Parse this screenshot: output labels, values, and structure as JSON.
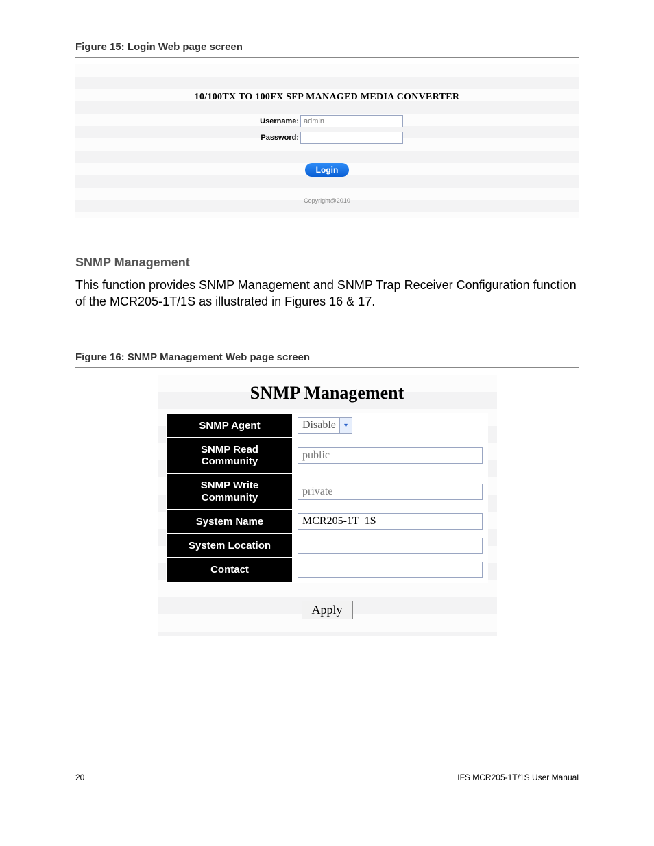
{
  "figure15": {
    "caption": "Figure 15: Login Web page screen",
    "title": "10/100TX TO 100FX SFP MANAGED MEDIA CONVERTER",
    "username_label": "Username:",
    "username_value": "admin",
    "password_label": "Password:",
    "password_value": "",
    "login_button": "Login",
    "copyright": "Copyright@2010"
  },
  "section": {
    "heading": "SNMP Management",
    "body": "This function provides SNMP Management and SNMP Trap Receiver Configuration function of the MCR205-1T/1S as illustrated in Figures 16 & 17."
  },
  "figure16": {
    "caption": "Figure 16: SNMP Management Web page screen",
    "title": "SNMP Management",
    "rows": {
      "snmp_agent": {
        "label": "SNMP Agent",
        "value": "Disable"
      },
      "read_community": {
        "label": "SNMP Read Community",
        "placeholder": "public"
      },
      "write_community": {
        "label": "SNMP Write Community",
        "placeholder": "private"
      },
      "system_name": {
        "label": "System Name",
        "value": "MCR205-1T_1S"
      },
      "system_location": {
        "label": "System Location",
        "value": ""
      },
      "contact": {
        "label": "Contact",
        "value": ""
      }
    },
    "apply_button": "Apply"
  },
  "footer": {
    "page_number": "20",
    "doc_title": "IFS MCR205-1T/1S User Manual"
  }
}
